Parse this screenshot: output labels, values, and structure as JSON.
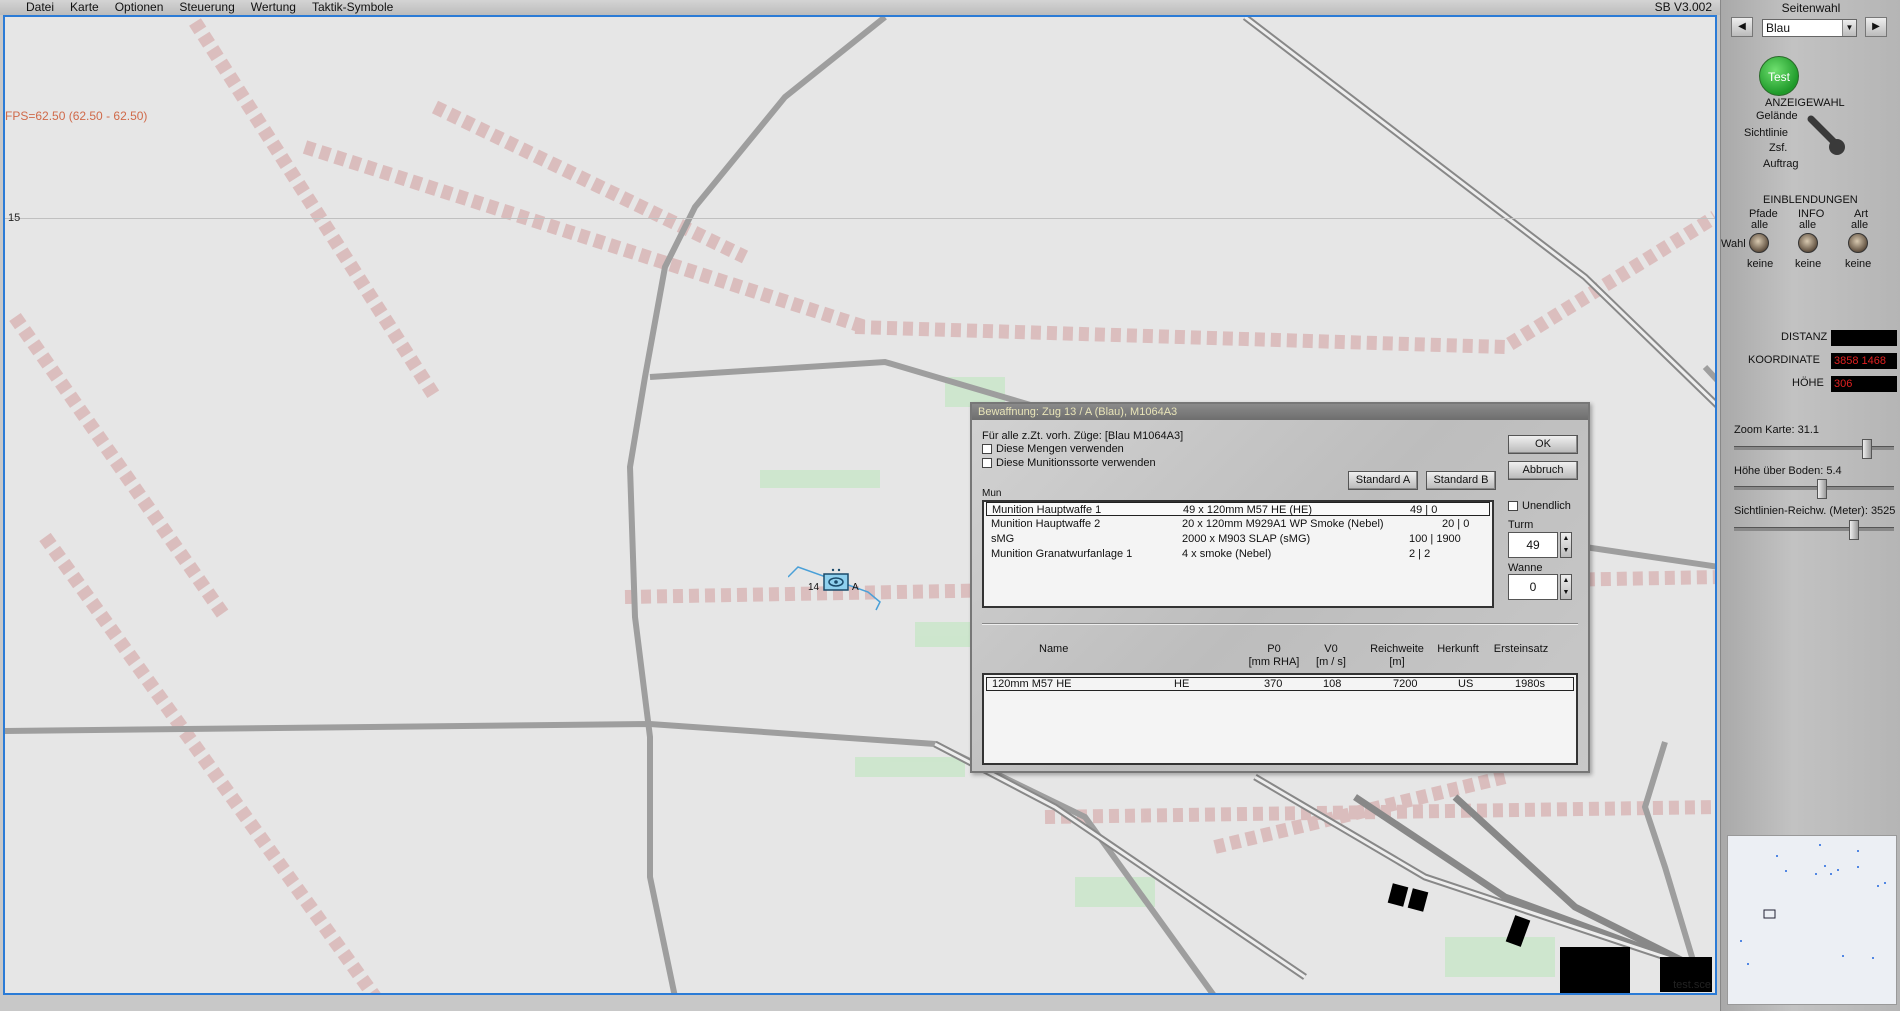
{
  "menu": [
    "Datei",
    "Karte",
    "Optionen",
    "Steuerung",
    "Wertung",
    "Taktik-Symbole"
  ],
  "version": "SB V3.002",
  "map": {
    "fps": "FPS=62.50 (62.50 - 62.50)",
    "grid_label": "15",
    "unit": {
      "number": "14",
      "suffix": "A"
    },
    "file": "test.sce"
  },
  "panel": {
    "title": "Seitenwahl",
    "side_selected": "Blau",
    "test_button": "Test",
    "anzeigewahl": {
      "heading": "ANZEIGEWAHL",
      "options": [
        "Gelände",
        "Sichtlinie",
        "Zsf.",
        "Auftrag"
      ]
    },
    "einblendungen": {
      "heading": "EINBLENDUNGEN",
      "row_label": "Wahl",
      "columns": [
        {
          "name": "Pfade",
          "top": "alle",
          "bottom": "keine"
        },
        {
          "name": "INFO",
          "top": "alle",
          "bottom": "keine"
        },
        {
          "name": "Art",
          "top": "alle",
          "bottom": "keine"
        }
      ]
    },
    "readouts": {
      "distanz_label": "DISTANZ",
      "distanz_value": "",
      "koordinate_label": "KOORDINATE",
      "koordinate_value": "3858 1468",
      "hoehe_label": "HÖHE",
      "hoehe_value": "306"
    },
    "sliders": {
      "zoom_label": "Zoom Karte:",
      "zoom_value": "31.1",
      "zoom_level": 0.83,
      "height_label": "Höhe über Boden:",
      "height_value": "5.4",
      "height_level": 0.55,
      "sight_label": "Sichtlinien-Reichw. (Meter):",
      "sight_value": "3525",
      "sight_level": 0.75
    }
  },
  "dialog": {
    "title": "Bewaffnung: Zug 13 / A (Blau), M1064A3",
    "for_all": "Für alle z.Zt. vorh. Züge: [Blau M1064A3]",
    "chk_mengen": "Diese Mengen verwenden",
    "chk_sorte": "Diese Munitionssorte verwenden",
    "btn_ok": "OK",
    "btn_abbruch": "Abbruch",
    "btn_std_a": "Standard A",
    "btn_std_b": "Standard B",
    "mun_label": "Mun",
    "unendlich": "Unendlich",
    "turm_label": "Turm",
    "turm_value": "49",
    "wanne_label": "Wanne",
    "wanne_value": "0",
    "ammo": [
      {
        "weapon": "Munition Hauptwaffe 1",
        "load": "49  x  120mm M57 HE (HE)",
        "split": "49  |  0"
      },
      {
        "weapon": "Munition Hauptwaffe 2",
        "load": "20  x  120mm M929A1 WP Smoke (Nebel)",
        "split": "20  |  0"
      },
      {
        "weapon": "sMG",
        "load": "2000  x  M903 SLAP (sMG)",
        "split": "100  |  1900"
      },
      {
        "weapon": "Munition Granatwurfanlage 1",
        "load": "4  x  smoke (Nebel)",
        "split": "2  |  2"
      }
    ],
    "headers": {
      "name": "Name",
      "p0": "P0",
      "p0_unit": "[mm RHA]",
      "v0": "V0",
      "v0_unit": "[m / s]",
      "range": "Reichweite",
      "range_unit": "[m]",
      "origin": "Herkunft",
      "first_use": "Ersteinsatz"
    },
    "detail": {
      "name": "120mm M57 HE",
      "type": "HE",
      "p0": "370",
      "v0": "108",
      "range": "7200",
      "origin": "US",
      "first_use": "1980s"
    }
  }
}
